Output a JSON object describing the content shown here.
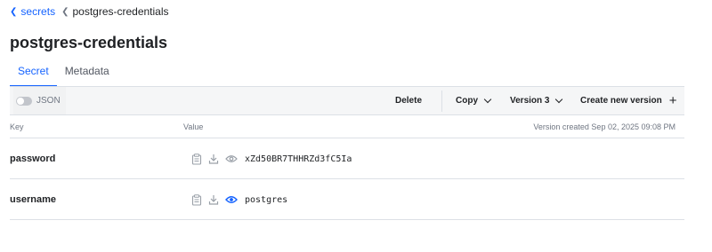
{
  "breadcrumb": {
    "parent": "secrets",
    "current": "postgres-credentials"
  },
  "page": {
    "title": "postgres-credentials"
  },
  "tabs": [
    {
      "label": "Secret",
      "active": true
    },
    {
      "label": "Metadata",
      "active": false
    }
  ],
  "toolbar": {
    "json_toggle_label": "JSON",
    "json_toggle_on": false,
    "delete_label": "Delete",
    "copy_label": "Copy",
    "version_label": "Version 3",
    "create_version_label": "Create new version"
  },
  "table": {
    "key_header": "Key",
    "value_header": "Value",
    "version_created": "Version created Sep 02, 2025 09:08 PM",
    "rows": [
      {
        "key": "password",
        "value": "xZd50BR7THHRZd3fC5Ia",
        "revealed": false
      },
      {
        "key": "username",
        "value": "postgres",
        "revealed": true
      }
    ]
  },
  "colors": {
    "accent": "#1563ff",
    "text": "#1f2124",
    "muted": "#6f7682",
    "border": "#dce0e6",
    "toolbar_bg": "#f5f6f7"
  }
}
